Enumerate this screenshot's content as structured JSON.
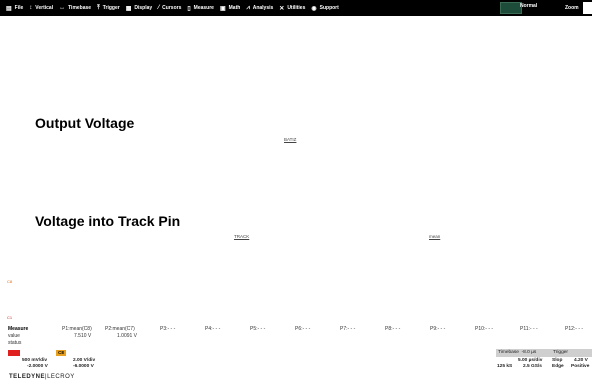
{
  "menu": [
    {
      "icon": "file-icon",
      "glyph": "▤",
      "label": "File"
    },
    {
      "icon": "vertical-icon",
      "glyph": "↕",
      "label": "Vertical"
    },
    {
      "icon": "timebase-icon",
      "glyph": "↔",
      "label": "Timebase"
    },
    {
      "icon": "trigger-icon",
      "glyph": "⤒",
      "label": "Trigger"
    },
    {
      "icon": "display-icon",
      "glyph": "▦",
      "label": "Display"
    },
    {
      "icon": "cursors-icon",
      "glyph": "⁄",
      "label": "Cursors"
    },
    {
      "icon": "measure-icon",
      "glyph": "▯",
      "label": "Measure"
    },
    {
      "icon": "math-icon",
      "glyph": "▣",
      "label": "Math"
    },
    {
      "icon": "analysis-icon",
      "glyph": "⩘",
      "label": "Analysis"
    },
    {
      "icon": "utilities-icon",
      "glyph": "✕",
      "label": "Utilities"
    },
    {
      "icon": "support-icon",
      "glyph": "◉",
      "label": "Support"
    }
  ],
  "trigger_mode": "Normal",
  "zoom_label": "Zoom",
  "labels": {
    "output_voltage": "Output Voltage",
    "voltage_track": "Voltage into Track Pin",
    "tag_batiz": "BATIZ",
    "tag_track": "TRACK",
    "tag_mean": "mean",
    "marker_c8": "C8",
    "marker_c1": "C1"
  },
  "measure": {
    "header": "Measure",
    "row_value": "value",
    "row_status": "status",
    "columns": [
      {
        "name": "P1:mean(C8)",
        "value": "7.510 V"
      },
      {
        "name": "P2:mean(C7)",
        "value": "1.0091 V"
      },
      {
        "name": "P3:- - -",
        "value": ""
      },
      {
        "name": "P4:- - -",
        "value": ""
      },
      {
        "name": "P5:- - -",
        "value": ""
      },
      {
        "name": "P6:- - -",
        "value": ""
      },
      {
        "name": "P7:- - -",
        "value": ""
      },
      {
        "name": "P8:- - -",
        "value": ""
      },
      {
        "name": "P9:- - -",
        "value": ""
      },
      {
        "name": "P10:- - -",
        "value": ""
      },
      {
        "name": "P11:- - -",
        "value": ""
      },
      {
        "name": "P12:- - -",
        "value": ""
      }
    ]
  },
  "channels": {
    "c1": {
      "vdiv": "500 mV/div",
      "offset": "-2.0000 V"
    },
    "c8": {
      "label": "C8",
      "vdiv": "2.00 V/div",
      "offset": "-6.0000 V"
    }
  },
  "timebase": {
    "header": "Timebase",
    "delay": "-8.0 µs",
    "tdiv": "5.00 µs/div",
    "samples": "125 kS",
    "rate": "2.5 GS/s"
  },
  "trigger": {
    "header": "Trigger",
    "type": "Slop",
    "level": "4.20 V",
    "coupling": "Edge",
    "slope": "Positive"
  },
  "logo": {
    "brand": "TELEDYNE",
    "sub": "LECROY"
  },
  "colors": {
    "c1": "#e0201e",
    "c8": "#e8a020",
    "menubar": "#000000"
  }
}
